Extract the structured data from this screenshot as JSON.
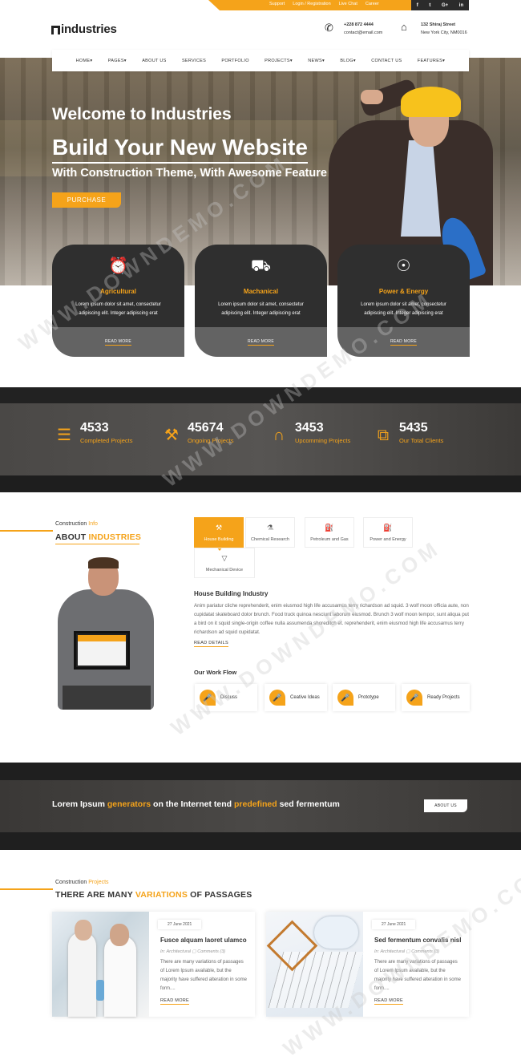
{
  "topbar": {
    "links": [
      "Support",
      "Login / Registration",
      "Live Chat",
      "Career"
    ],
    "social": [
      "f",
      "t",
      "G+",
      "in"
    ]
  },
  "header": {
    "logo_text": "industries",
    "phone": "+228 872 4444",
    "email": "contact@email.com",
    "address1": "132 Shiraj Street",
    "address2": "New York City, NM0016"
  },
  "nav": [
    "HOME▾",
    "PAGES▾",
    "ABOUT US",
    "SERVICES",
    "PORTFOLIO",
    "PROJECTS▾",
    "NEWS▾",
    "BLOG▾",
    "CONTACT US",
    "FEATURES▾"
  ],
  "hero": {
    "welcome": "Welcome to Industries",
    "headline": "Build Your New Website",
    "subline": "With Construction Theme, With Awesome Feature",
    "button": "PURCHASE"
  },
  "services": [
    {
      "title": "Agricultural",
      "desc": "Lorem ipsum dolor sit amet, consectetur adipiscing elit. Integer adipiscing erat",
      "more": "READ MORE",
      "icon": "⏰"
    },
    {
      "title": "Machanical",
      "desc": "Lorem ipsum dolor sit amet, consectetur adipiscing elit. Integer adipiscing erat",
      "more": "READ MORE",
      "icon": "⛟"
    },
    {
      "title": "Power & Energy",
      "desc": "Lorem ipsum dolor sit amet, consectetur adipiscing elit. Integer adipiscing erat",
      "more": "READ MORE",
      "icon": "☉"
    }
  ],
  "counters": [
    {
      "num": "4533",
      "label": "Completed Projects",
      "icon": "☰"
    },
    {
      "num": "45674",
      "label": "Ongoing Projects",
      "icon": "⚒"
    },
    {
      "num": "3453",
      "label": "Upcomming Projects",
      "icon": "∩"
    },
    {
      "num": "5435",
      "label": "Our Total Clients",
      "icon": "⧉"
    }
  ],
  "about": {
    "small_a": "Construction ",
    "small_b": "Info",
    "title_a": "ABOUT ",
    "title_b": "INDUSTRIES",
    "tabs": [
      "House Building",
      "Chemical Research",
      "Petroleum and Gas",
      "Power and Energy",
      "Mechanical Device"
    ],
    "heading": "House Building Industry",
    "para": "Anim pariatur cliche reprehenderit, enim eiusmod high life accusamus terry richardson ad squid. 3 wolf moon officia aute, non cupidatat skateboard dolor brunch. Food truck quinoa nesciunt laborum eiusmod. Brunch 3 wolf moon tempor, sunt aliqua put a bird on it squid single-origin coffee nulla assumenda shoreditch et. reprehenderit, enim eiusmod high life accusamus terry richardson ad squid cupidatat.",
    "read": "READ DETAILS",
    "flow_title": "Our Work Flow",
    "flows": [
      "Discuss",
      "Ceative Ideas",
      "Prototype",
      "Ready Projects"
    ]
  },
  "cta": {
    "t1": "Lorem Ipsum ",
    "t2": "generators",
    "t3": " on the Internet tend ",
    "t4": "predefined",
    "t5": " sed fermentum",
    "button": "ABOUT US"
  },
  "projects": {
    "small_a": "Construction ",
    "small_b": "Projects",
    "title_a": "THERE ARE MANY ",
    "title_b": "VARIATIONS",
    "title_c": " OF PASSAGES",
    "items": [
      {
        "date": "27 June 2021",
        "title": "Fusce alquam laoret ulamco",
        "meta": "In: Architectural   ▢ Comments (3)",
        "desc": "There are many variations of passages of Lorem Ipsum available, but the majority have suffered alteration in some form....",
        "more": "READ MORE"
      },
      {
        "date": "27 June 2021",
        "title": "Sed fermentum convalis nisl",
        "meta": "In: Architectural   ▢ Comments (3)",
        "desc": "There are many variations of passages of Lorem Ipsum available, but the majority have suffered alteration in some form....",
        "more": "READ MORE"
      }
    ]
  },
  "watermark": "WWW.DOWNDEMO.COM",
  "colors": {
    "accent": "#f5a31a",
    "dark": "#2f2f2f"
  }
}
